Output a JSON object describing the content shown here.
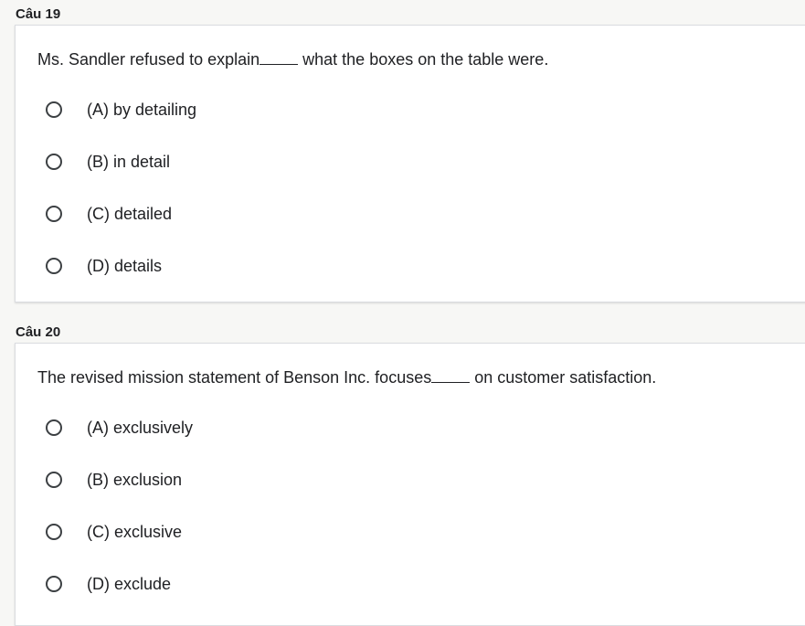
{
  "questions": [
    {
      "label": "Câu 19",
      "text_before": "Ms. Sandler refused to explain",
      "text_after": " what the boxes on the table were.",
      "options": [
        "(A) by detailing",
        "(B) in detail",
        "(C) detailed",
        "(D) details"
      ]
    },
    {
      "label": "Câu 20",
      "text_before": "The revised mission statement of Benson Inc. focuses",
      "text_after": " on customer satisfaction.",
      "options": [
        "(A) exclusively",
        "(B) exclusion",
        "(C) exclusive",
        "(D) exclude"
      ]
    }
  ]
}
